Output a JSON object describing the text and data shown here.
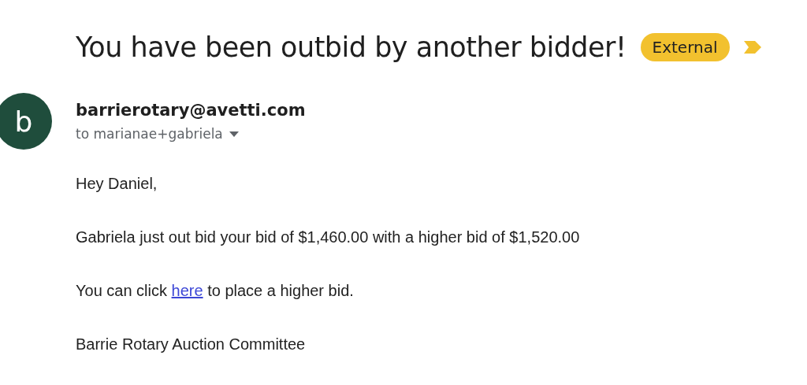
{
  "subject": "You have been outbid by another bidder!",
  "label": {
    "text": "External",
    "color": "#f2c12e"
  },
  "important": true,
  "sender": {
    "avatar_letter": "b",
    "email": "barrierotary@avetti.com",
    "recipients": "to marianae+gabriela"
  },
  "body": [
    {
      "kind": "text",
      "text": "Hey Daniel,"
    },
    {
      "kind": "text",
      "text": "Gabriela just out bid your bid of $1,460.00 with a higher bid of $1,520.00"
    },
    {
      "kind": "link",
      "before": "You can click ",
      "link": "here",
      "after": " to place a higher bid."
    },
    {
      "kind": "text",
      "text": "Barrie Rotary Auction Committee"
    }
  ]
}
